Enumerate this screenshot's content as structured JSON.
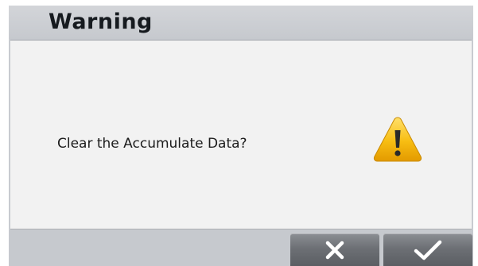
{
  "dialog": {
    "title": "Warning",
    "message": "Clear the Accumulate Data?",
    "icon": "warning-triangle-icon",
    "buttons": {
      "cancel_icon": "close-icon",
      "confirm_icon": "checkmark-icon"
    }
  },
  "colors": {
    "header_bg": "#c8cbd0",
    "body_bg": "#f2f2f2",
    "button_bg": "#6d7075",
    "warning_yellow": "#f5b800"
  }
}
